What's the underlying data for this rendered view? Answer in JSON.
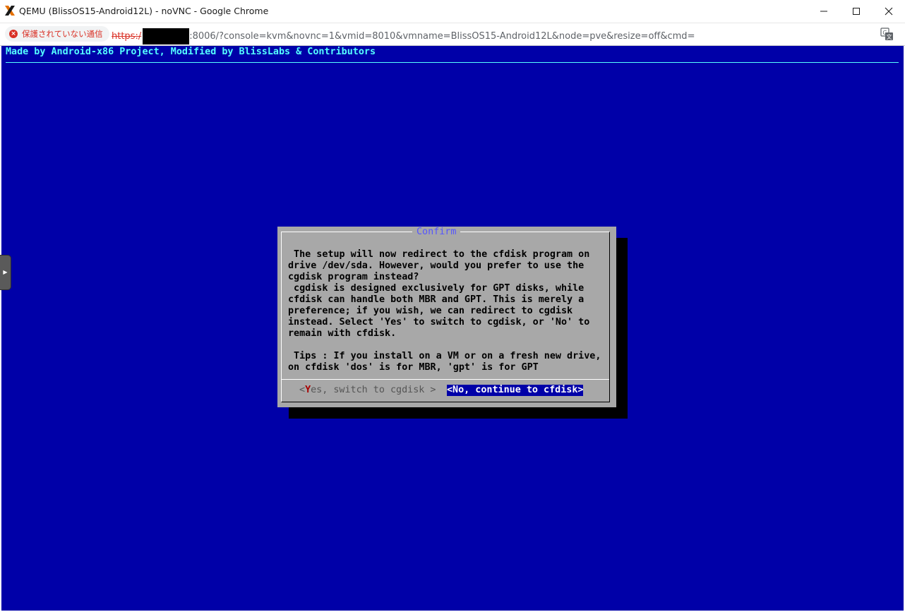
{
  "window": {
    "title": "QEMU (BlissOS15-Android12L) - noVNC - Google Chrome",
    "app_icon": "proxmox-x-icon"
  },
  "addressbar": {
    "security_label": "保護されていない通信",
    "url_scheme": "https:/",
    "url_rest": ":8006/?console=kvm&novnc=1&vmid=8010&vmname=BlissOS15-Android12L&node=pve&resize=off&cmd="
  },
  "console": {
    "banner": "Made by Android-x86 Project, Modified by BlissLabs & Contributors",
    "dialog": {
      "title": "Confirm",
      "body": " The setup will now redirect to the cfdisk program on\ndrive /dev/sda. However, would you prefer to use the\ncgdisk program instead?\n cgdisk is designed exclusively for GPT disks, while\ncfdisk can handle both MBR and GPT. This is merely a\npreference; if you wish, we can redirect to cgdisk\ninstead. Select 'Yes' to switch to cgdisk, or 'No' to\nremain with cfdisk.\n\n Tips : If you install on a VM or on a fresh new drive,\non cfdisk 'dos' is for MBR, 'gpt' is for GPT",
      "yes_open": "<",
      "yes_hotkey": "Y",
      "yes_rest": "es, switch to cgdisk >",
      "no_label": "<No, continue to cfdisk>"
    }
  },
  "colors": {
    "console_bg": "#0000a8",
    "banner": "#55ffff",
    "dialog_bg": "#a8a8a8",
    "dialog_title": "#5555ff",
    "selected_button_bg": "#0000a8",
    "insecure_red": "#d93025"
  }
}
